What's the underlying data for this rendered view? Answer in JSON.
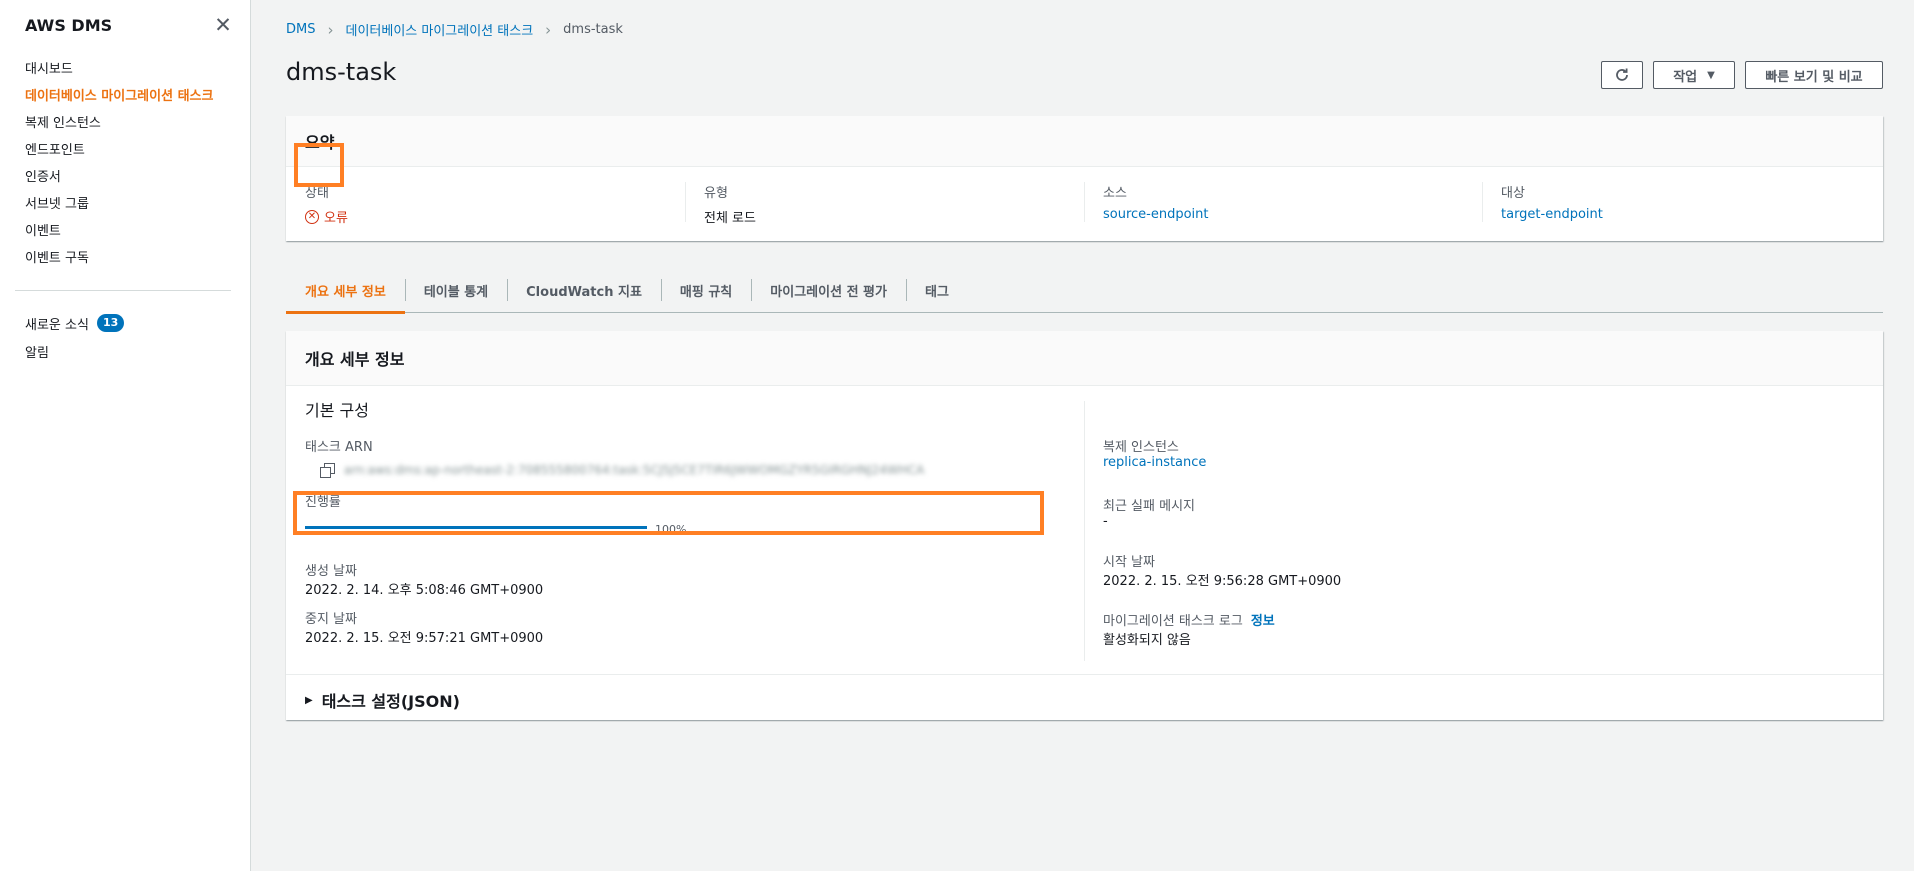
{
  "sidebar": {
    "title": "AWS DMS",
    "close_glyph": "✕",
    "items": [
      {
        "label": "대시보드"
      },
      {
        "label": "데이터베이스 마이그레이션 태스크"
      },
      {
        "label": "복제 인스턴스"
      },
      {
        "label": "엔드포인트"
      },
      {
        "label": "인증서"
      },
      {
        "label": "서브넷 그룹"
      },
      {
        "label": "이벤트"
      },
      {
        "label": "이벤트 구독"
      }
    ],
    "whats_new": {
      "label": "새로운 소식",
      "badge": "13"
    },
    "notifications": {
      "label": "알림"
    }
  },
  "breadcrumb": {
    "items": [
      "DMS",
      "데이터베이스 마이그레이션 태스크",
      "dms-task"
    ],
    "separator": "›"
  },
  "page": {
    "title": "dms-task"
  },
  "header_buttons": {
    "refresh_icon": "refresh-icon",
    "actions_label": "작업",
    "actions_caret": "▼",
    "compare_label": "빠른 보기 및 비교"
  },
  "summary": {
    "heading": "요약",
    "status": {
      "label": "상태",
      "icon_glyph": "✕",
      "value": "오류"
    },
    "type": {
      "label": "유형",
      "value": "전체 로드"
    },
    "source": {
      "label": "소스",
      "value": "source-endpoint"
    },
    "target": {
      "label": "대상",
      "value": "target-endpoint"
    }
  },
  "tabs": [
    {
      "label": "개요 세부 정보",
      "active": true
    },
    {
      "label": "테이블 통계"
    },
    {
      "label": "CloudWatch 지표"
    },
    {
      "label": "매핑 규칙"
    },
    {
      "label": "마이그레이션 전 평가"
    },
    {
      "label": "태그"
    }
  ],
  "details": {
    "heading": "개요 세부 정보",
    "section_title": "기본 구성",
    "task_arn": {
      "label": "태스크 ARN",
      "value": "arn:aws:dms:ap-northeast-2:708555800764:task:5CJ5J5CE7TIR6JWWOMGZYR5GIRGHNJ24WHCA"
    },
    "progress": {
      "label": "진행률",
      "percent": 100,
      "percent_text": "100%"
    },
    "created": {
      "label": "생성 날짜",
      "value": "2022. 2. 14. 오후 5:08:46 GMT+0900"
    },
    "stopped": {
      "label": "중지 날짜",
      "value": "2022. 2. 15. 오전 9:57:21 GMT+0900"
    },
    "replication_instance": {
      "label": "복제 인스턴스",
      "value": "replica-instance"
    },
    "last_failure": {
      "label": "최근 실패 메시지",
      "value": "-"
    },
    "started": {
      "label": "시작 날짜",
      "value": "2022. 2. 15. 오전 9:56:28 GMT+0900"
    },
    "task_log": {
      "label": "마이그레이션 태스크 로그",
      "info_link": "정보",
      "value": "활성화되지 않음"
    },
    "settings_expander": {
      "label": "태스크 설정(JSON)",
      "glyph": "▶"
    }
  },
  "colors": {
    "accent": "#ec7211",
    "link": "#0073bb",
    "error": "#d13212",
    "highlight": "#ff7f24"
  }
}
